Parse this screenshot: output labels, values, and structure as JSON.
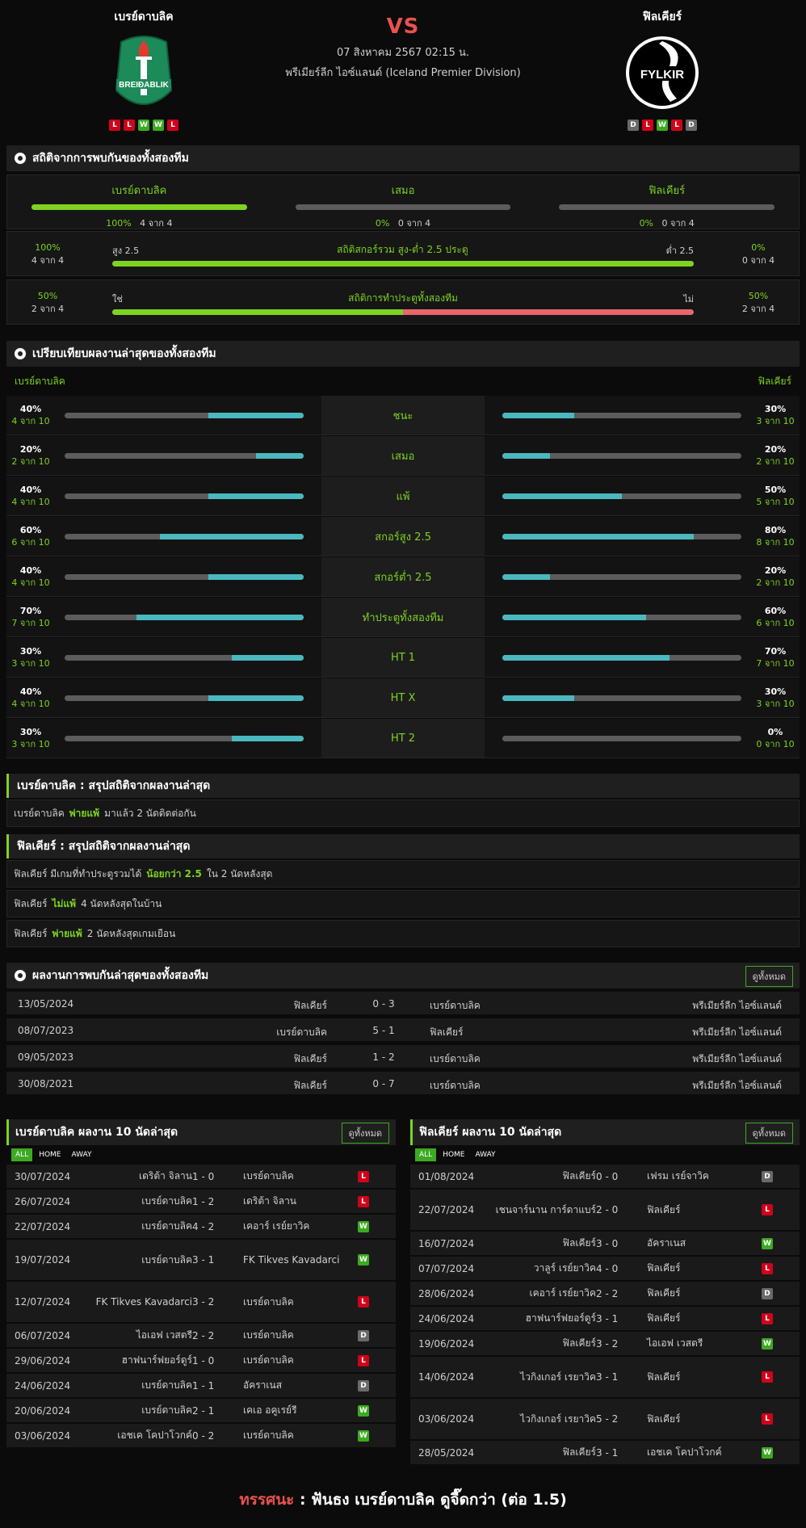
{
  "match": {
    "home_name": "เบรย์ดาบลิค",
    "away_name": "ฟิลเคียร์",
    "vs": "VS",
    "date": "07 สิงหาคม 2567 02:15 น.",
    "league": "พรีเมียร์ลีก ไอซ์แลนด์ (Iceland Premier Division)",
    "home_logo_text": "BREIÐABLIK",
    "away_logo_text": "FYLKIR",
    "home_form": [
      "L",
      "L",
      "W",
      "W",
      "L"
    ],
    "away_form": [
      "D",
      "L",
      "W",
      "L",
      "D"
    ]
  },
  "h2h_stats": {
    "title": "สถิติจากการพบกันของทั้งสองทีม",
    "cols": [
      {
        "label": "เบรย์ดาบลิค",
        "pct": "100%",
        "count": "4 จาก 4",
        "value": 1.0
      },
      {
        "label": "เสมอ",
        "pct": "0%",
        "count": "0 จาก 4",
        "value": 0
      },
      {
        "label": "ฟิลเคียร์",
        "pct": "0%",
        "count": "0 จาก 4",
        "value": 0
      }
    ],
    "ou": {
      "title": "สถิติสกอร์รวม สูง-ต่ำ 2.5 ประตู",
      "left_pct": "100%",
      "left_count": "4 จาก 4",
      "left_label": "สูง 2.5",
      "right_label": "ต่ำ 2.5",
      "right_pct": "0%",
      "right_count": "0 จาก 4",
      "value": 1.0
    },
    "btts": {
      "title": "สถิติการทำประตูทั้งสองทีม",
      "left_pct": "50%",
      "left_count": "2 จาก 4",
      "left_label": "ใช่",
      "right_label": "ไม่",
      "right_pct": "50%",
      "right_count": "2 จาก 4",
      "value": 0.5
    }
  },
  "compare": {
    "title": "เปรียบเทียบผลงานล่าสุดของทั้งสองทีม",
    "home_label": "เบรย์ดาบลิค",
    "away_label": "ฟิลเคียร์",
    "rows": [
      {
        "label": "ชนะ",
        "hp": "40%",
        "hc": "4 จาก 10",
        "hv": 0.4,
        "ap": "30%",
        "ac": "3 จาก 10",
        "av": 0.3
      },
      {
        "label": "เสมอ",
        "hp": "20%",
        "hc": "2 จาก 10",
        "hv": 0.2,
        "ap": "20%",
        "ac": "2 จาก 10",
        "av": 0.2
      },
      {
        "label": "แพ้",
        "hp": "40%",
        "hc": "4 จาก 10",
        "hv": 0.4,
        "ap": "50%",
        "ac": "5 จาก 10",
        "av": 0.5
      },
      {
        "label": "สกอร์สูง 2.5",
        "hp": "60%",
        "hc": "6 จาก 10",
        "hv": 0.6,
        "ap": "80%",
        "ac": "8 จาก 10",
        "av": 0.8
      },
      {
        "label": "สกอร์ต่ำ 2.5",
        "hp": "40%",
        "hc": "4 จาก 10",
        "hv": 0.4,
        "ap": "20%",
        "ac": "2 จาก 10",
        "av": 0.2
      },
      {
        "label": "ทำประตูทั้งสองทีม",
        "hp": "70%",
        "hc": "7 จาก 10",
        "hv": 0.7,
        "ap": "60%",
        "ac": "6 จาก 10",
        "av": 0.6
      },
      {
        "label": "HT 1",
        "hp": "30%",
        "hc": "3 จาก 10",
        "hv": 0.3,
        "ap": "70%",
        "ac": "7 จาก 10",
        "av": 0.7
      },
      {
        "label": "HT X",
        "hp": "40%",
        "hc": "4 จาก 10",
        "hv": 0.4,
        "ap": "30%",
        "ac": "3 จาก 10",
        "av": 0.3
      },
      {
        "label": "HT 2",
        "hp": "30%",
        "hc": "3 จาก 10",
        "hv": 0.3,
        "ap": "0%",
        "ac": "0 จาก 10",
        "av": 0
      }
    ]
  },
  "summary_home": {
    "title": "เบรย์ดาบลิค : สรุปสถิติจากผลงานล่าสุด",
    "rows": [
      {
        "pre": "เบรย์ดาบลิค",
        "hl": "พ่ายแพ้",
        "post": "มาแล้ว 2 นัดติดต่อกัน"
      }
    ]
  },
  "summary_away": {
    "title": "ฟิลเคียร์ : สรุปสถิติจากผลงานล่าสุด",
    "rows": [
      {
        "pre": "ฟิลเคียร์ มีเกมที่ทำประตูรวมได้",
        "hl": "น้อยกว่า 2.5",
        "post": "ใน 2 นัดหลังสุด"
      },
      {
        "pre": "ฟิลเคียร์",
        "hl": "ไม่แพ้",
        "post": "4 นัดหลังสุดในบ้าน"
      },
      {
        "pre": "ฟิลเคียร์",
        "hl": "พ่ายแพ้",
        "post": "2 นัดหลังสุดเกมเยือน"
      }
    ]
  },
  "h2h_results": {
    "title": "ผลงานการพบกันล่าสุดของทั้งสองทีม",
    "view_all": "ดูทั้งหมด",
    "rows": [
      {
        "date": "13/05/2024",
        "home": "ฟิลเคียร์",
        "score": "0 - 3",
        "away": "เบรย์ดาบลิค",
        "league": "พรีเมียร์ลีก ไอซ์แลนด์"
      },
      {
        "date": "08/07/2023",
        "home": "เบรย์ดาบลิค",
        "score": "5 - 1",
        "away": "ฟิลเคียร์",
        "league": "พรีเมียร์ลีก ไอซ์แลนด์"
      },
      {
        "date": "09/05/2023",
        "home": "ฟิลเคียร์",
        "score": "1 - 2",
        "away": "เบรย์ดาบลิค",
        "league": "พรีเมียร์ลีก ไอซ์แลนด์"
      },
      {
        "date": "30/08/2021",
        "home": "ฟิลเคียร์",
        "score": "0 - 7",
        "away": "เบรย์ดาบลิค",
        "league": "พรีเมียร์ลีก ไอซ์แลนด์"
      }
    ]
  },
  "tabs": [
    "ALL",
    "HOME",
    "AWAY"
  ],
  "home_last10": {
    "title": "เบรย์ดาบลิค ผลงาน 10 นัดล่าสุด",
    "view_all": "ดูทั้งหมด",
    "rows": [
      {
        "date": "30/07/2024",
        "home": "เดริต้า จิลาน",
        "score": "1 - 0",
        "away": "เบรย์ดาบลิค",
        "res": "L"
      },
      {
        "date": "26/07/2024",
        "home": "เบรย์ดาบลิค",
        "score": "1 - 2",
        "away": "เดริต้า จิลาน",
        "res": "L"
      },
      {
        "date": "22/07/2024",
        "home": "เบรย์ดาบลิค",
        "score": "4 - 2",
        "away": "เคอาร์ เรย์ยาวิค",
        "res": "W"
      },
      {
        "date": "19/07/2024",
        "home": "เบรย์ดาบลิค",
        "score": "3 - 1",
        "away": "FK Tikves Kavadarci",
        "res": "W"
      },
      {
        "date": "12/07/2024",
        "home": "FK Tikves Kavadarci",
        "score": "3 - 2",
        "away": "เบรย์ดาบลิค",
        "res": "L"
      },
      {
        "date": "06/07/2024",
        "home": "ไอเอฟ เวสตรี",
        "score": "2 - 2",
        "away": "เบรย์ดาบลิค",
        "res": "D"
      },
      {
        "date": "29/06/2024",
        "home": "ฮาฟนาร์ฟยอร์ดูร์",
        "score": "1 - 0",
        "away": "เบรย์ดาบลิค",
        "res": "L"
      },
      {
        "date": "24/06/2024",
        "home": "เบรย์ดาบลิค",
        "score": "1 - 1",
        "away": "อัคราเนส",
        "res": "D"
      },
      {
        "date": "20/06/2024",
        "home": "เบรย์ดาบลิค",
        "score": "2 - 1",
        "away": "เคเอ อคูเรย์รี",
        "res": "W"
      },
      {
        "date": "03/06/2024",
        "home": "เอชเค โคปาโวกค์",
        "score": "0 - 2",
        "away": "เบรย์ดาบลิค",
        "res": "W"
      }
    ]
  },
  "away_last10": {
    "title": "ฟิลเคียร์ ผลงาน 10 นัดล่าสุด",
    "view_all": "ดูทั้งหมด",
    "rows": [
      {
        "date": "01/08/2024",
        "home": "ฟิลเคียร์",
        "score": "0 - 0",
        "away": "เฟรม เรย์จาวิค",
        "res": "D"
      },
      {
        "date": "22/07/2024",
        "home": "เชนจาร์นาน การ์ดาแบร์",
        "score": "2 - 0",
        "away": "ฟิลเคียร์",
        "res": "L"
      },
      {
        "date": "16/07/2024",
        "home": "ฟิลเคียร์",
        "score": "3 - 0",
        "away": "อัคราเนส",
        "res": "W"
      },
      {
        "date": "07/07/2024",
        "home": "วาลูร์ เรย์ยาวิค",
        "score": "4 - 0",
        "away": "ฟิลเคียร์",
        "res": "L"
      },
      {
        "date": "28/06/2024",
        "home": "เคอาร์ เรย์ยาวิค",
        "score": "2 - 2",
        "away": "ฟิลเคียร์",
        "res": "D"
      },
      {
        "date": "24/06/2024",
        "home": "ฮาฟนาร์ฟยอร์ดูร์",
        "score": "3 - 1",
        "away": "ฟิลเคียร์",
        "res": "L"
      },
      {
        "date": "19/06/2024",
        "home": "ฟิลเคียร์",
        "score": "3 - 2",
        "away": "ไอเอฟ เวสตรี",
        "res": "W"
      },
      {
        "date": "14/06/2024",
        "home": "ไวกิงเกอร์ เรยาวิค",
        "score": "3 - 1",
        "away": "ฟิลเคียร์",
        "res": "L"
      },
      {
        "date": "03/06/2024",
        "home": "ไวกิงเกอร์ เรยาวิค",
        "score": "5 - 2",
        "away": "ฟิลเคียร์",
        "res": "L"
      },
      {
        "date": "28/05/2024",
        "home": "ฟิลเคียร์",
        "score": "3 - 1",
        "away": "เอชเค โคปาโวกค์",
        "res": "W"
      }
    ]
  },
  "verdict": {
    "key": "ทรรศนะ",
    "sep": ":",
    "text": "ฟันธง เบรย์ดาบลิค ดูจี๊ดกว่า (ต่อ 1.5)"
  },
  "colors": {
    "accent_green": "#7ed321",
    "bar_cyan": "#4ab8bf",
    "bar_red": "#e8676b",
    "bar_grey": "#5c5c5c"
  }
}
